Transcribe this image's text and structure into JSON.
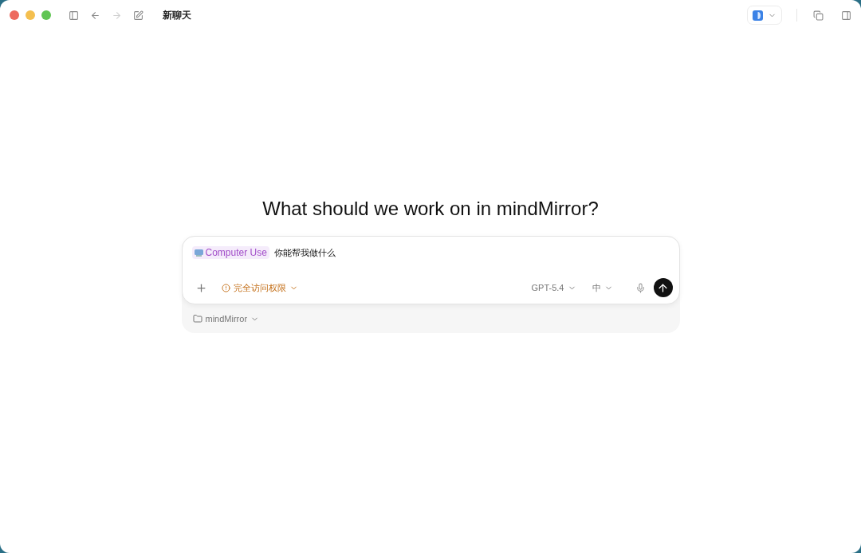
{
  "window": {
    "title": "新聊天"
  },
  "nav": {
    "back_disabled": false,
    "forward_disabled": true
  },
  "heading": "What should we work on in mindMirror?",
  "composer": {
    "chip": "Computer Use",
    "value": "你能帮我做什么",
    "access": "完全访问权限",
    "model": "GPT-5.4",
    "effort": "中"
  },
  "project": {
    "name": "mindMirror"
  }
}
